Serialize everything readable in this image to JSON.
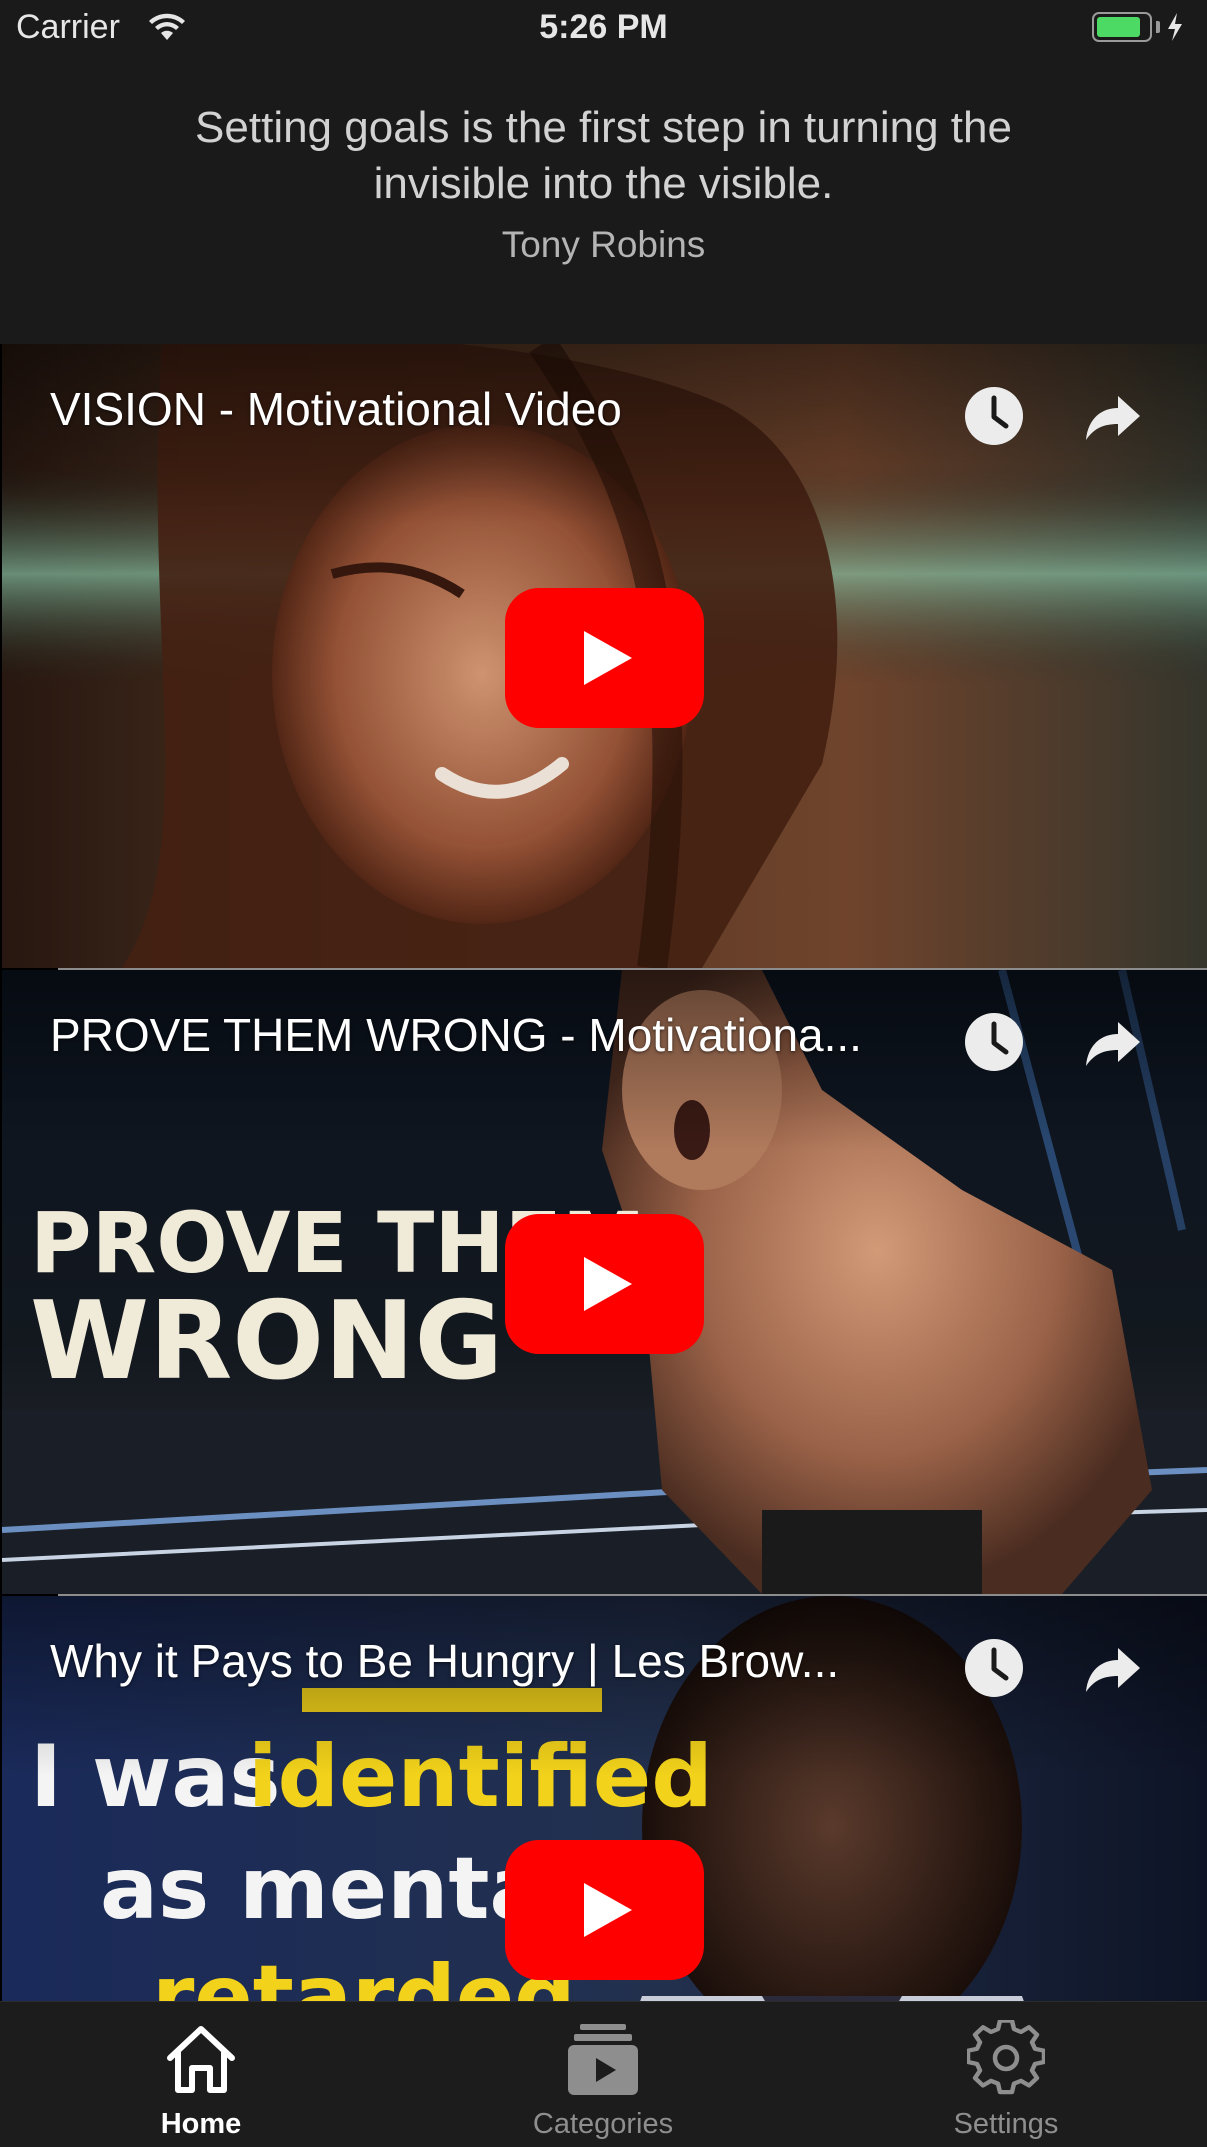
{
  "status_bar": {
    "carrier": "Carrier",
    "time": "5:26 PM",
    "battery_level": 0.85,
    "battery_color": "#4cd964"
  },
  "quote": {
    "text": "Setting goals is the first step in turning the invisible into the visible.",
    "author": "Tony Robins"
  },
  "videos": [
    {
      "title": "VISION - Motivational Video",
      "icons": [
        "clock-icon",
        "share-icon",
        "play-icon"
      ]
    },
    {
      "title": "PROVE THEM WRONG - Motivationa...",
      "thumbnail_text": [
        "PROVE THEM",
        "WRONG"
      ],
      "icons": [
        "clock-icon",
        "share-icon",
        "play-icon"
      ]
    },
    {
      "title": "Why it Pays to Be Hungry | Les Brow...",
      "thumbnail_text": [
        "I was",
        "identified",
        "as mentally",
        "retarded"
      ],
      "icons": [
        "clock-icon",
        "share-icon",
        "play-icon"
      ]
    }
  ],
  "tab_bar": {
    "tabs": [
      {
        "label": "Home",
        "icon": "home-icon",
        "active": true
      },
      {
        "label": "Categories",
        "icon": "categories-icon",
        "active": false
      },
      {
        "label": "Settings",
        "icon": "gear-icon",
        "active": false
      }
    ]
  },
  "colors": {
    "background": "#1a1a1a",
    "play_button": "#ff0000",
    "highlight_yellow": "#f2d21a"
  }
}
